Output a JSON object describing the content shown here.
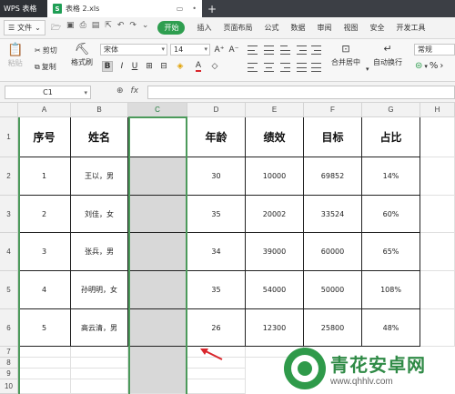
{
  "app": {
    "name": "WPS 表格",
    "doc_tab": "表格 2.xls",
    "doc_icon_letter": "S",
    "new_tab": "+"
  },
  "menu": {
    "file": "文件",
    "items": [
      "开始",
      "插入",
      "页面布局",
      "公式",
      "数据",
      "审阅",
      "视图",
      "安全",
      "开发工具"
    ],
    "active_index": 0
  },
  "toolbar": {
    "paste": "粘贴",
    "cut": "剪切",
    "copy": "复制",
    "format_painter": "格式刷",
    "font_name": "宋体",
    "font_size": "14",
    "grow_font": "A⁺",
    "shrink_font": "A⁻",
    "bold": "B",
    "italic": "I",
    "underline": "U",
    "merge_center": "合并居中",
    "wrap_text": "自动换行",
    "number_format": "常规",
    "percent": "%"
  },
  "formula_bar": {
    "name_box": "C1",
    "fx": "fx",
    "value": ""
  },
  "sheet": {
    "columns": [
      "A",
      "B",
      "C",
      "D",
      "E",
      "F",
      "G",
      "H"
    ],
    "selected_column": "C",
    "row_numbers": [
      "1",
      "2",
      "3",
      "4",
      "5",
      "6",
      "7",
      "8",
      "9",
      "10"
    ],
    "headers": [
      "序号",
      "姓名",
      "",
      "年龄",
      "绩效",
      "目标",
      "占比"
    ],
    "rows": [
      [
        "1",
        "王以，男",
        "",
        "30",
        "10000",
        "69852",
        "14%"
      ],
      [
        "2",
        "刘佳，女",
        "",
        "35",
        "20002",
        "33524",
        "60%"
      ],
      [
        "3",
        "张兵，男",
        "",
        "34",
        "39000",
        "60000",
        "65%"
      ],
      [
        "4",
        "孙明明，女",
        "",
        "35",
        "54000",
        "50000",
        "108%"
      ],
      [
        "5",
        "高云清，男",
        "",
        "26",
        "12300",
        "25800",
        "48%"
      ]
    ]
  },
  "watermark": {
    "title": "青花安卓网",
    "url": "www.qhhlv.com"
  },
  "colors": {
    "accent": "#2e9e4f",
    "selection": "#4c9a5b",
    "arrow": "#d9262c"
  }
}
